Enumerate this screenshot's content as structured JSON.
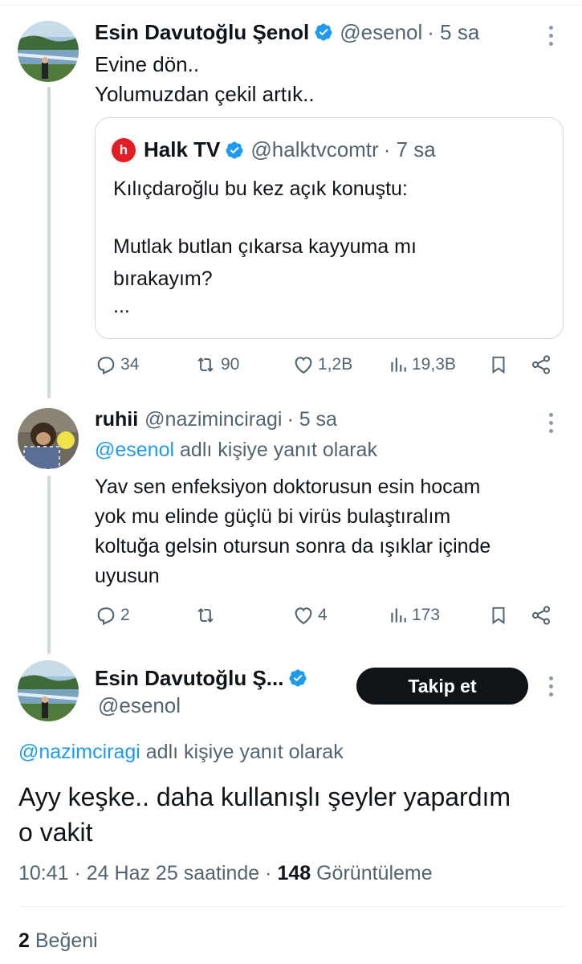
{
  "tweet1": {
    "name": "Esin Davutoğlu Şenol",
    "handle": "@esenol",
    "time": "· 5 sa",
    "text_line1": "Evine dön..",
    "text_line2": "Yolumuzdan çekil artık..",
    "quote": {
      "logo": "h",
      "name": "Halk TV",
      "handle": "@halktvcomtr",
      "time": "· 7 sa",
      "line1": "Kılıçdaroğlu bu kez açık konuştu:",
      "line2": "Mutlak butlan çıkarsa kayyuma mı",
      "line3": "bırakayım?",
      "line4": "..."
    },
    "actions": {
      "replies": "34",
      "reposts": "90",
      "likes": "1,2B",
      "views": "19,3B"
    }
  },
  "tweet2": {
    "name": "ruhii",
    "handle": "@naziminciragi",
    "time": "· 5 sa",
    "reply_mention": "@esenol",
    "reply_suffix": "adlı kişiye yanıt olarak",
    "line1": "Yav sen enfeksiyon doktorusun esin hocam",
    "line2": "yok mu elinde güçlü bi virüs bulaştıralım",
    "line3": "koltuğa gelsin otursun sonra da ışıklar içinde",
    "line4": "uyusun",
    "actions": {
      "replies": "2",
      "reposts": "",
      "likes": "4",
      "views": "173"
    }
  },
  "main_tweet": {
    "name": "Esin Davutoğlu Ş...",
    "handle": "@esenol",
    "follow_label": "Takip et",
    "reply_mention": "@nazimciragi",
    "reply_suffix": "adlı kişiye yanıt olarak",
    "line1": "Ayy keşke.. daha kullanışlı şeyler yapardım",
    "line2": "o vakit",
    "time": "10:41 · 24 Haz 25 saatinde ·",
    "views_count": "148",
    "views_label": "Görüntüleme",
    "likes_count": "2",
    "likes_label": "Beğeni"
  },
  "icons": [
    "verified-badge-icon",
    "more-icon",
    "reply-icon",
    "repost-icon",
    "like-icon",
    "views-icon",
    "bookmark-icon",
    "share-icon"
  ],
  "colors": {
    "accent": "#1d9bf0",
    "text": "#0f1419",
    "secondary": "#536471",
    "follow_bg": "#0f1419",
    "halktv_red": "#e21d25"
  }
}
